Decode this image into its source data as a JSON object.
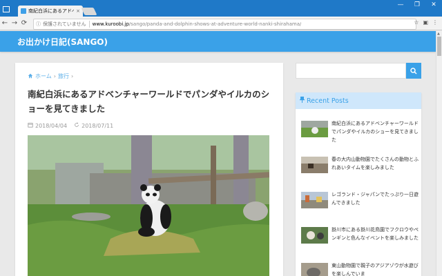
{
  "browser": {
    "tab_title": "南紀白浜にあるアドベンチ",
    "tab_close": "×",
    "window_controls": [
      "—",
      "❐",
      "✕"
    ],
    "url_info": "ⓘ",
    "url_security": "保護されていません",
    "url_host": "www.kuroobi.jp",
    "url_path": "/sango/panda-and-dolphin-shows-at-adventure-world-nanki-shirahama/",
    "nav": {
      "back": "←",
      "forward": "→",
      "reload": "⟳"
    },
    "toolbar_right": [
      "☆",
      "▣",
      "⋮"
    ]
  },
  "site": {
    "title": "お出かけ日記(SANGO)"
  },
  "article": {
    "breadcrumb": [
      {
        "label": "ホーム",
        "icon": "home-icon"
      },
      {
        "label": "旅行"
      }
    ],
    "breadcrumb_sep": "›",
    "title": "南紀白浜にあるアドベンチャーワールドでパンダやイルカのショーを見てきました",
    "published": "2018/04/04",
    "updated": "2018/07/11"
  },
  "search": {
    "placeholder": "",
    "button_icon": "search-icon"
  },
  "recent": {
    "heading": "Recent Posts",
    "posts": [
      {
        "title": "南紀白浜にあるアドベンチャーワールドでパンダやイルカのショーを見てきました"
      },
      {
        "title": "春の大内山動物園でたくさんの動物とふれあいタイムを楽しみました"
      },
      {
        "title": "レゴランド・ジャパンでたっぷり一日遊んできました"
      },
      {
        "title": "掛川市にある掛川花鳥園でフクロウやペンギンと色んなイベントを楽しみました"
      },
      {
        "title": "東山動物園で親子のアジアゾウが水遊びを楽しんでいま"
      }
    ]
  },
  "colors": {
    "accent": "#3aa1e8",
    "titlebar": "#1f79c8",
    "recent_head_bg": "#cfe7fb"
  }
}
